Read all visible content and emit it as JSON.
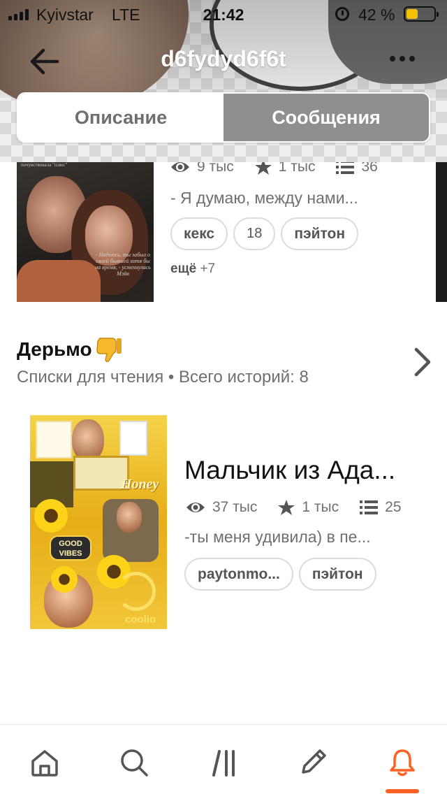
{
  "status_bar": {
    "carrier": "Kyivstar",
    "network": "LTE",
    "time": "21:42",
    "battery": "42 %",
    "battery_level": 0.42
  },
  "header": {
    "title": "d6fydyd6f6t",
    "back_icon": "arrow-left-icon",
    "more_icon": "more-horizontal-icon"
  },
  "tabs": [
    {
      "label": "Описание",
      "active": false
    },
    {
      "label": "Сообщения",
      "active": true
    }
  ],
  "story1": {
    "views": "9 тыс",
    "votes": "1 тыс",
    "parts": "36",
    "description": "- Я думаю, между нами...",
    "tags": [
      "кекс",
      "18",
      "пэйтон"
    ],
    "more_prefix": "ещё",
    "more_count": "+7",
    "cover_text": "- Надеюсь, ты забыл о своей бывшей хотя бы на время, - усмехнулась Мэйв",
    "cover_top_text": "почувствовала \"плюс\""
  },
  "reading_list": {
    "title": "Дерьмо",
    "emoji": "thumbs-down-emoji",
    "meta_label": "Списки для чтения • Всего историй:",
    "meta_count": "8"
  },
  "story2": {
    "title": "Мальчик из Ада...",
    "views": "37 тыс",
    "votes": "1 тыс",
    "parts": "25",
    "description": "-ты меня удивила) в пе...",
    "tags": [
      "paytonmo...",
      "пэйтон"
    ],
    "cover_badge": "GOOD VIBES",
    "cover_honey": "Honey",
    "cover_coolio": "coolio"
  },
  "tabbar": {
    "items": [
      "home-icon",
      "search-icon",
      "library-icon",
      "write-icon",
      "notifications-icon"
    ],
    "active": "notifications-icon",
    "accent_color": "#ff6122"
  }
}
